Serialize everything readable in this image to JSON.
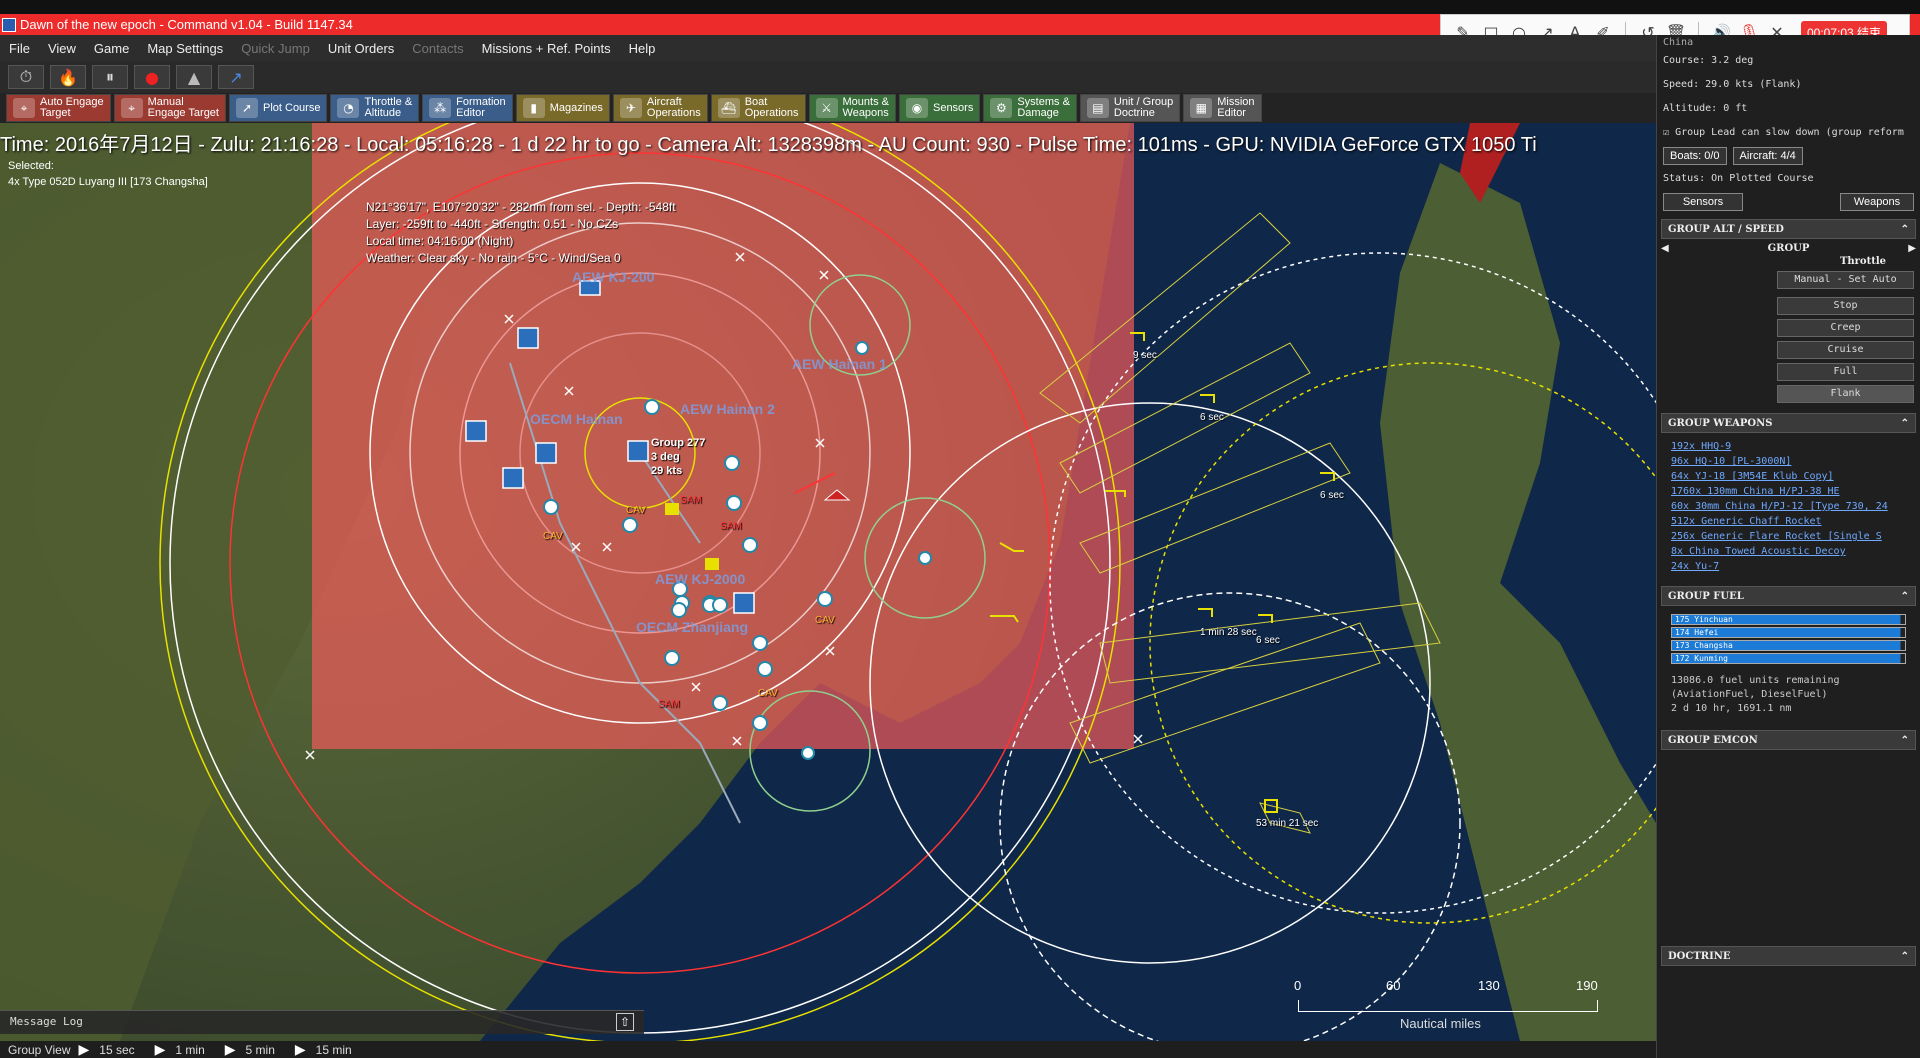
{
  "window": {
    "title": "Dawn of the new epoch - Command v1.04 - Build 1147.34"
  },
  "recorder": {
    "timer": "00:07:03 结束"
  },
  "menu": [
    "File",
    "View",
    "Game",
    "Map Settings",
    "Quick Jump",
    "Unit Orders",
    "Contacts",
    "Missions + Ref. Points",
    "Help"
  ],
  "tabs": [
    {
      "label": "Auto Engage\nTarget",
      "color": "#9b3a30",
      "icon": "crosshair-icon"
    },
    {
      "label": "Manual\nEngage Target",
      "color": "#9b3a30",
      "icon": "crosshair-icon"
    },
    {
      "label": "Plot Course",
      "color": "#3a5d8a",
      "icon": "compass-icon"
    },
    {
      "label": "Throttle &\nAltitude",
      "color": "#3a5d8a",
      "icon": "gauge-icon"
    },
    {
      "label": "Formation\nEditor",
      "color": "#3a5d8a",
      "icon": "formation-icon"
    },
    {
      "label": "Magazines",
      "color": "#7a6a2a",
      "icon": "ammo-icon"
    },
    {
      "label": "Aircraft\nOperations",
      "color": "#7a6a2a",
      "icon": "aircraft-icon"
    },
    {
      "label": "Boat\nOperations",
      "color": "#7a6a2a",
      "icon": "boat-icon"
    },
    {
      "label": "Mounts &\nWeapons",
      "color": "#3a6e3a",
      "icon": "weapons-icon"
    },
    {
      "label": "Sensors",
      "color": "#3a6e3a",
      "icon": "sensor-icon"
    },
    {
      "label": "Systems &\nDamage",
      "color": "#3a6e3a",
      "icon": "gear-icon"
    },
    {
      "label": "Unit / Group\nDoctrine",
      "color": "#555555",
      "icon": "doctrine-icon"
    },
    {
      "label": "Mission\nEditor",
      "color": "#555555",
      "icon": "editor-icon"
    }
  ],
  "status": {
    "line": "Time: 2016年7月12日 - Zulu: 21:16:28 - Local: 05:16:28 - 1 d 22 hr to go -  Camera Alt: 1328398m  - AU Count: 930 - Pulse Time: 101ms - GPU: NVIDIA GeForce GTX 1050 Ti"
  },
  "selection": {
    "label": "Selected:",
    "unit": "4x Type 052D Luyang III [173 Changsha]"
  },
  "cursor": {
    "line1": "N21°36'17\", E107°20'32\" - 282nm from sel. - Depth: -548ft",
    "line2": "Layer: -259ft to -440ft - Strength: 0.51 - No CZs",
    "line3": "Local time: 04:16:00 (Night)",
    "line4": "Weather: Clear sky - No rain - 5°C - Wind/Sea 0"
  },
  "map_labels": {
    "aew1": "AEW KJ-200",
    "aew_hainan1": "AEW Hainan 1",
    "oecm_hainan": "OECM Hainan",
    "aew_hainan2": "AEW Hainan 2",
    "aew2": "AEW KJ-2000",
    "oecm_zhanjiang": "OECM Zhanjiang",
    "group_name": "Group 277",
    "group_course": "3 deg",
    "group_speed": "29 kts",
    "cav": "CAV",
    "sam": "SAM"
  },
  "time_labels": [
    "9 sec",
    "6 sec",
    "6 sec",
    "1 min 28 sec",
    "6 sec",
    "53 min 21 sec"
  ],
  "scale": {
    "ticks": [
      "0",
      "60",
      "130",
      "190"
    ],
    "unit": "Nautical miles"
  },
  "message_log": "Message Log",
  "bottom": {
    "view": "Group View",
    "steps": [
      "15 sec",
      "1 min",
      "5 min",
      "15 min"
    ]
  },
  "panel": {
    "country": "China",
    "course": "Course: 3.2 deg",
    "speed": "Speed: 29.0 kts (Flank)",
    "altitude": "Altitude: 0 ft",
    "lead_note": "Group Lead can slow down (group reform",
    "boats": "Boats: 0/0",
    "aircraft": "Aircraft: 4/4",
    "status": "Status: On Plotted Course",
    "sensors_btn": "Sensors",
    "weapons_btn": "Weapons",
    "sec_alt": "GROUP ALT / SPEED",
    "group_label": "GROUP",
    "throttle_label": "Throttle",
    "manual_btn": "Manual - Set Auto",
    "speeds": [
      "Stop",
      "Creep",
      "Cruise",
      "Full",
      "Flank"
    ],
    "sec_weapons": "GROUP WEAPONS",
    "weapons": [
      "192x HHQ-9",
      "96x HQ-10 [PL-3000N]",
      "64x YJ-18 [3M54E Klub Copy]",
      "1760x 130mm China H/PJ-38 HE",
      "60x 30mm China H/PJ-12 [Type 730, 24",
      "512x Generic Chaff Rocket",
      "256x Generic Flare Rocket [Single S",
      "8x China Towed Acoustic Decoy",
      "24x Yu-7"
    ],
    "sec_fuel": "GROUP FUEL",
    "fuel": [
      {
        "name": "175 Yinchuan",
        "level": 0.98
      },
      {
        "name": "174 Hefei",
        "level": 0.98
      },
      {
        "name": "173 Changsha",
        "level": 0.98
      },
      {
        "name": "172 Kunming",
        "level": 0.98
      }
    ],
    "fuel_text1": "13086.0 fuel units remaining",
    "fuel_text2": "(AviationFuel, DieselFuel)",
    "fuel_text3": "2 d 10 hr, 1691.1 nm",
    "sec_emcon": "GROUP EMCON",
    "sec_doctrine": "DOCTRINE"
  }
}
